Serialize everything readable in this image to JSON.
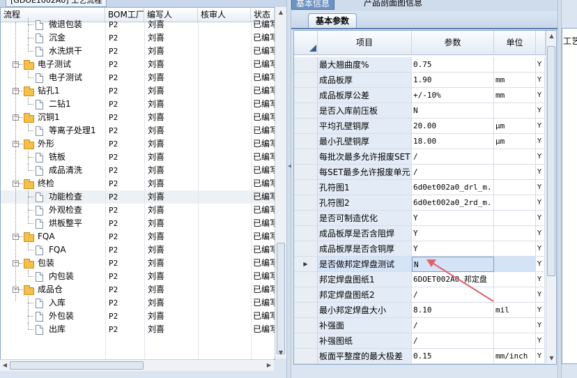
{
  "left_panel": {
    "tab_label": "[GDOE1002A0] 工艺流程",
    "columns": [
      "流程",
      "BOM工厂",
      "编写人",
      "核审人",
      "状态"
    ],
    "rows": [
      {
        "level": 2,
        "type": "doc",
        "label": "微退包装",
        "factory": "P2",
        "writer": "刘喜",
        "reviewer": "",
        "status": "已编写"
      },
      {
        "level": 2,
        "type": "doc",
        "label": "沉金",
        "factory": "P2",
        "writer": "刘喜",
        "reviewer": "",
        "status": "已编写"
      },
      {
        "level": 2,
        "type": "doc",
        "label": "水洗烘干",
        "factory": "P2",
        "writer": "刘喜",
        "reviewer": "",
        "status": "已编写"
      },
      {
        "level": 1,
        "type": "folder",
        "label": "电子测试",
        "factory": "P2",
        "writer": "刘喜",
        "reviewer": "",
        "status": "已编写"
      },
      {
        "level": 2,
        "type": "doc",
        "label": "电子测试",
        "factory": "P2",
        "writer": "刘喜",
        "reviewer": "",
        "status": "已编写"
      },
      {
        "level": 1,
        "type": "folder",
        "label": "钻孔1",
        "factory": "P2",
        "writer": "刘喜",
        "reviewer": "",
        "status": "已编写"
      },
      {
        "level": 2,
        "type": "doc",
        "label": "二钻1",
        "factory": "P2",
        "writer": "刘喜",
        "reviewer": "",
        "status": "已编写"
      },
      {
        "level": 1,
        "type": "folder",
        "label": "沉铜1",
        "factory": "P2",
        "writer": "刘喜",
        "reviewer": "",
        "status": "已编写"
      },
      {
        "level": 2,
        "type": "doc",
        "label": "等离子处理1",
        "factory": "P2",
        "writer": "刘喜",
        "reviewer": "",
        "status": "已编写"
      },
      {
        "level": 1,
        "type": "folder",
        "label": "外形",
        "factory": "P2",
        "writer": "刘喜",
        "reviewer": "",
        "status": "已编写"
      },
      {
        "level": 2,
        "type": "doc",
        "label": "铣板",
        "factory": "P2",
        "writer": "刘喜",
        "reviewer": "",
        "status": "已编写"
      },
      {
        "level": 2,
        "type": "doc",
        "label": "成品清洗",
        "factory": "P2",
        "writer": "刘喜",
        "reviewer": "",
        "status": "已编写"
      },
      {
        "level": 1,
        "type": "folder",
        "label": "终检",
        "factory": "P2",
        "writer": "刘喜",
        "reviewer": "",
        "status": "已编写"
      },
      {
        "level": 2,
        "type": "doc",
        "label": "功能检查",
        "factory": "P2",
        "writer": "刘喜",
        "reviewer": "",
        "status": "已编写",
        "selected": true
      },
      {
        "level": 2,
        "type": "doc",
        "label": "外观检查",
        "factory": "P2",
        "writer": "刘喜",
        "reviewer": "",
        "status": "已编写"
      },
      {
        "level": 2,
        "type": "doc",
        "label": "烘板整平",
        "factory": "P2",
        "writer": "刘喜",
        "reviewer": "",
        "status": "已编写"
      },
      {
        "level": 1,
        "type": "folder",
        "label": "FQA",
        "factory": "P2",
        "writer": "刘喜",
        "reviewer": "",
        "status": "已编写"
      },
      {
        "level": 2,
        "type": "doc",
        "label": "FQA",
        "factory": "P2",
        "writer": "刘喜",
        "reviewer": "",
        "status": "已编写"
      },
      {
        "level": 1,
        "type": "folder",
        "label": "包装",
        "factory": "P2",
        "writer": "刘喜",
        "reviewer": "",
        "status": "已编写"
      },
      {
        "level": 2,
        "type": "doc",
        "label": "内包装",
        "factory": "P2",
        "writer": "刘喜",
        "reviewer": "",
        "status": "已编写"
      },
      {
        "level": 1,
        "type": "folder",
        "label": "成品仓",
        "factory": "P2",
        "writer": "刘喜",
        "reviewer": "",
        "status": "已编写"
      },
      {
        "level": 2,
        "type": "doc",
        "label": "入库",
        "factory": "P2",
        "writer": "刘喜",
        "reviewer": "",
        "status": "已编写"
      },
      {
        "level": 2,
        "type": "doc",
        "label": "外包装",
        "factory": "P2",
        "writer": "刘喜",
        "reviewer": "",
        "status": "已编写"
      },
      {
        "level": 2,
        "type": "doc",
        "label": "出库",
        "factory": "P2",
        "writer": "刘喜",
        "reviewer": "",
        "status": "已编写"
      }
    ]
  },
  "right_panel": {
    "tabs": [
      "基本信息",
      "产品剖面图信息"
    ],
    "active_tab": 0,
    "subtab": "基本参数",
    "columns": [
      "项目",
      "参数",
      "单位"
    ],
    "rows": [
      {
        "item": "最大翘曲度%",
        "value": "0.75",
        "unit": "",
        "flag": "Y"
      },
      {
        "item": "成品板厚",
        "value": "1.90",
        "unit": "mm",
        "flag": "Y"
      },
      {
        "item": "成品板厚公差",
        "value": "+/-10%",
        "unit": "mm",
        "flag": "Y"
      },
      {
        "item": "是否入库前压板",
        "value": "N",
        "unit": "",
        "flag": "Y"
      },
      {
        "item": "平均孔壁铜厚",
        "value": "20.00",
        "unit": "μm",
        "flag": "Y"
      },
      {
        "item": "最小孔壁铜厚",
        "value": "18.00",
        "unit": "μm",
        "flag": "Y"
      },
      {
        "item": "每批次最多允许报废SET",
        "value": "/",
        "unit": "",
        "flag": "Y"
      },
      {
        "item": "每SET最多允许报废单元",
        "value": "/",
        "unit": "",
        "flag": "Y"
      },
      {
        "item": "孔符图1",
        "value": "6d0et002a0_drl_m...",
        "unit": "",
        "flag": "Y"
      },
      {
        "item": "孔符图2",
        "value": "6d0et002a0_2rd_m...",
        "unit": "",
        "flag": "Y"
      },
      {
        "item": "是否可制造优化",
        "value": "Y",
        "unit": "",
        "flag": "Y"
      },
      {
        "item": "成品板厚是否含阻焊",
        "value": "Y",
        "unit": "",
        "flag": "Y"
      },
      {
        "item": "成品板厚是否含铜厚",
        "value": "Y",
        "unit": "",
        "flag": "Y"
      },
      {
        "item": "是否做邦定焊盘测试",
        "value": "N",
        "unit": "",
        "flag": "Y",
        "current": true
      },
      {
        "item": "邦定焊盘图纸1",
        "value": "6DOET002A0.邦定盘",
        "unit": "",
        "flag": "Y"
      },
      {
        "item": "邦定焊盘图纸2",
        "value": "/",
        "unit": "",
        "flag": "Y"
      },
      {
        "item": "最小邦定焊盘大小",
        "value": "8.10",
        "unit": "mil",
        "flag": "Y"
      },
      {
        "item": "补强面",
        "value": "/",
        "unit": "",
        "flag": "Y"
      },
      {
        "item": "补强图纸",
        "value": "/",
        "unit": "",
        "flag": "Y"
      },
      {
        "item": "板面平整度的最大极差",
        "value": "0.15",
        "unit": "mm/inch",
        "flag": "Y"
      }
    ]
  },
  "far_panel": {
    "label": "工艺"
  },
  "colors": {
    "annotation_arrow": "#e0606a",
    "selection": "#d5e3f7"
  }
}
